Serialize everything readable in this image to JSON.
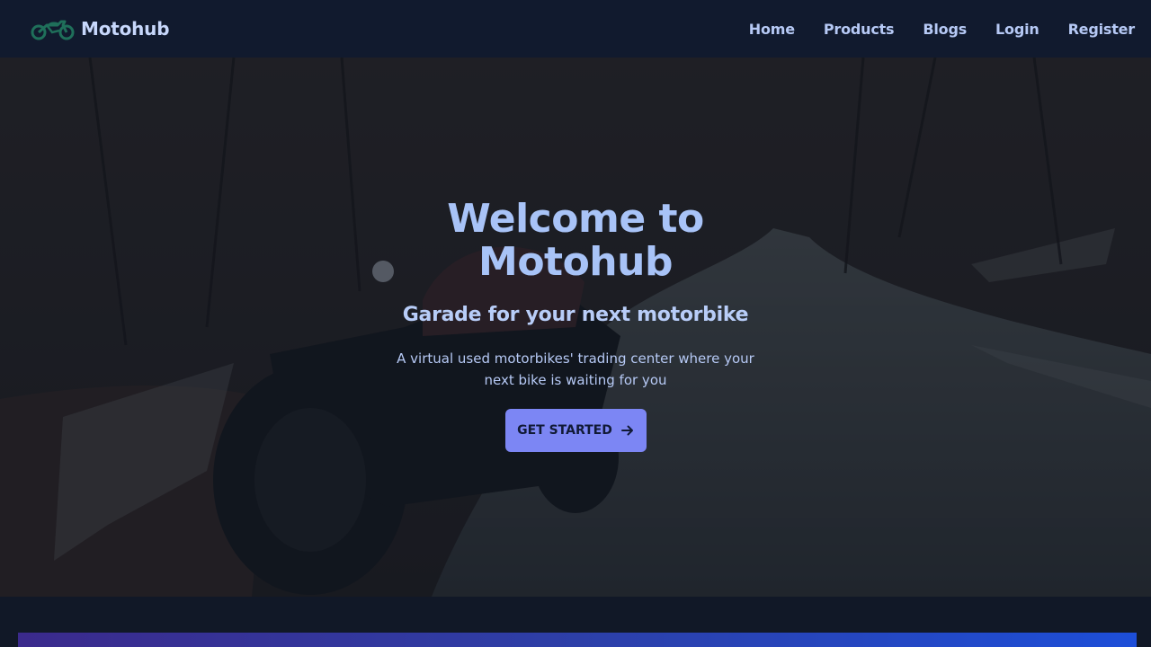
{
  "navbar": {
    "brand": "Motohub",
    "logo_icon": "motorcycle-icon",
    "links": [
      {
        "label": "Home"
      },
      {
        "label": "Products"
      },
      {
        "label": "Blogs"
      },
      {
        "label": "Login"
      },
      {
        "label": "Register"
      }
    ]
  },
  "hero": {
    "title": "Welcome to Motohub",
    "subtitle": "Garade for your next motorbike",
    "description": "A virtual used motorbikes' trading center where your next bike is waiting for you",
    "cta_label": "GET STARTED",
    "cta_icon": "arrow-right-icon",
    "background_image": "motorcycle-on-forest-road"
  },
  "colors": {
    "navbar_bg": "#111a2e",
    "brand_text": "#c7d7fb",
    "accent_button": "#7c86f4",
    "logo_green": "#1f6f5a"
  }
}
